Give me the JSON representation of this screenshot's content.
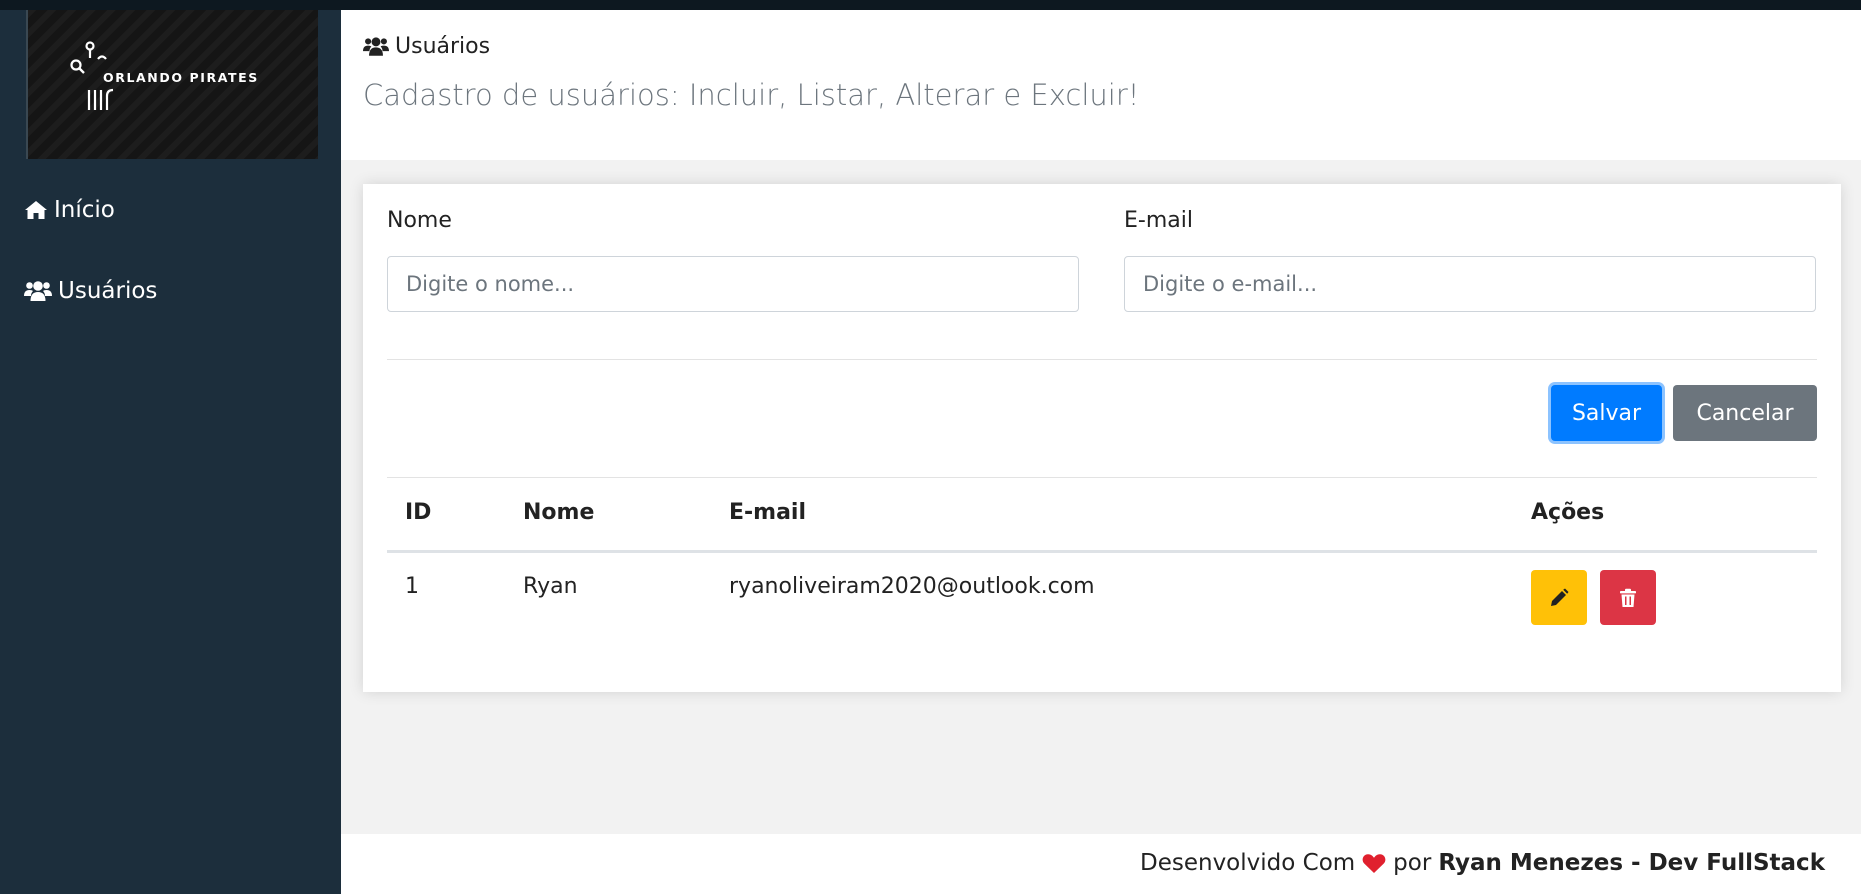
{
  "brand": {
    "logo_text": "ORLANDO PIRATES"
  },
  "sidebar": {
    "items": [
      {
        "label": "Início",
        "icon": "home-icon"
      },
      {
        "label": "Usuários",
        "icon": "users-icon"
      }
    ]
  },
  "header": {
    "title": "Usuários",
    "title_icon": "users-icon",
    "subtitle": "Cadastro de usuários: Incluir, Listar, Alterar e Excluir!"
  },
  "form": {
    "name_label": "Nome",
    "name_placeholder": "Digite o nome...",
    "name_value": "",
    "email_label": "E-mail",
    "email_placeholder": "Digite o e-mail...",
    "email_value": "",
    "save_label": "Salvar",
    "cancel_label": "Cancelar"
  },
  "table": {
    "headers": [
      "ID",
      "Nome",
      "E-mail",
      "Ações"
    ],
    "rows": [
      {
        "id": "1",
        "nome": "Ryan",
        "email": "ryanoliveiram2020@outlook.com"
      }
    ]
  },
  "footer": {
    "prefix": "Desenvolvido Com",
    "middle": "por",
    "author": "Ryan Menezes - Dev FullStack",
    "heart_icon": "heart-icon"
  },
  "colors": {
    "sidebar_bg": "#1c2e3c",
    "primary": "#007bff",
    "secondary": "#6c757d",
    "warning": "#ffc107",
    "danger": "#dc3545",
    "heart": "#e0202e"
  }
}
